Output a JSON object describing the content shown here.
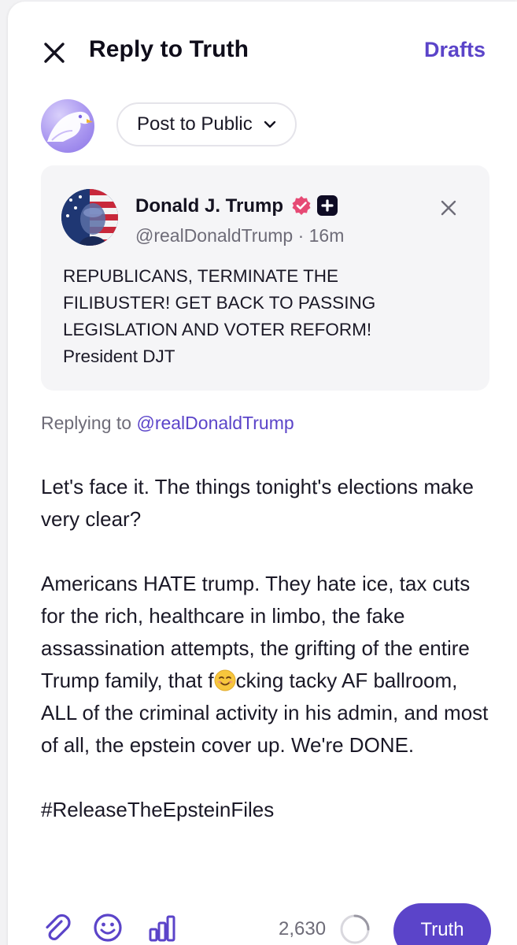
{
  "header": {
    "title": "Reply to Truth",
    "drafts_label": "Drafts"
  },
  "visibility": {
    "label": "Post to Public"
  },
  "quoted_post": {
    "author_name": "Donald J. Trump",
    "handle": "@realDonaldTrump",
    "separator": " · ",
    "time_ago": "16m",
    "text": "REPUBLICANS, TERMINATE THE FILIBUSTER! GET BACK TO PASSING LEGISLATION AND VOTER REFORM! President DJT",
    "lines": [
      "REPUBLICANS, TERMINATE THE",
      "FILIBUSTER! GET BACK TO PASSING",
      "LEGISLATION AND VOTER REFORM!",
      "President DJT"
    ]
  },
  "replying": {
    "prefix": "Replying to ",
    "mention": "@realDonaldTrump"
  },
  "compose": {
    "paragraph_1": "Let's face it. The things tonight's elections make very clear?",
    "paragraph_2_before_emoji": "Americans HATE trump. They hate ice, tax cuts for the rich, healthcare in limbo, the fake assassination attempts, the grifting of the entire Trump family, that f",
    "paragraph_2_after_emoji": "cking tacky AF ballroom, ALL of the criminal activity in his admin, and most of all, the epstein cover up. We're DONE.",
    "paragraph_3": "#ReleaseTheEpsteinFiles",
    "emoji": "smiling-face-emoji"
  },
  "toolbar": {
    "char_count": "2,630",
    "submit_label": "Truth",
    "icons": [
      "paperclip-icon",
      "smiley-icon",
      "poll-icon"
    ]
  },
  "colors": {
    "accent": "#5b44c9",
    "muted": "#6e6c78",
    "card_bg": "#f5f5f7"
  }
}
